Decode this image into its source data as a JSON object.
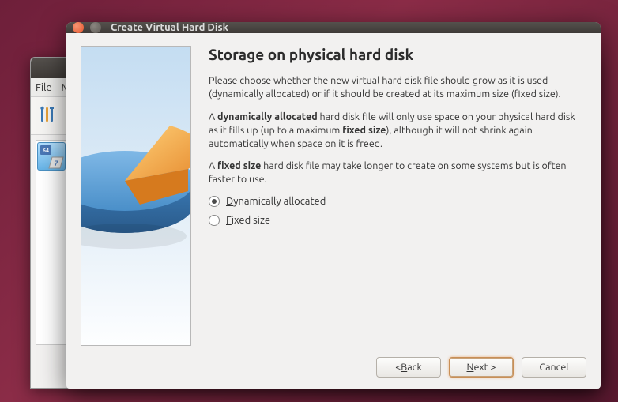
{
  "back_window": {
    "menu": {
      "file": "File",
      "m": "M"
    }
  },
  "dialog": {
    "title": "Create Virtual Hard Disk",
    "heading": "Storage on physical hard disk",
    "para1": "Please choose whether the new virtual hard disk file should grow as it is used (dynamically allocated) or if it should be created at its maximum size (fixed size).",
    "para2_a": "A ",
    "para2_b": "dynamically allocated",
    "para2_c": " hard disk file will only use space on your physical hard disk as it fills up (up to a maximum ",
    "para2_d": "fixed size",
    "para2_e": "), although it will not shrink again automatically when space on it is freed.",
    "para3_a": "A ",
    "para3_b": "fixed size",
    "para3_c": " hard disk file may take longer to create on some systems but is often faster to use.",
    "options": {
      "dynamic": {
        "ul": "D",
        "rest": "ynamically allocated",
        "selected": true
      },
      "fixed": {
        "ul": "F",
        "rest": "ixed size",
        "selected": false
      }
    },
    "buttons": {
      "back_lt": "< ",
      "back_ul": "B",
      "back_rest": "ack",
      "next_ul": "N",
      "next_rest": "ext >",
      "cancel": "Cancel"
    }
  }
}
